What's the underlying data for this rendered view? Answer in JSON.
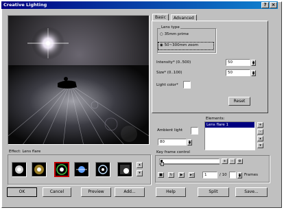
{
  "window": {
    "title": "Creative Lighting"
  },
  "tabs": [
    {
      "label": "Basic"
    },
    {
      "label": "Advanced"
    }
  ],
  "lens_type": {
    "group_title": "Lens type",
    "options": [
      {
        "label": "35mm prime",
        "selected": false
      },
      {
        "label": "50~300mm zoom",
        "selected": true
      }
    ]
  },
  "intensity": {
    "label": "Intensity* (0..500)",
    "value": "50"
  },
  "size": {
    "label": "Size* (0..100)",
    "value": "50"
  },
  "light_color": {
    "label": "Light color*"
  },
  "reset_label": "Reset",
  "elements": {
    "label": "Elements:",
    "items": [
      "Lens flare 1"
    ]
  },
  "ambient_light": {
    "label": "Ambient light",
    "value": "80"
  },
  "effect_strip": {
    "label": "Effect:",
    "value": "Lens flare"
  },
  "keyframe": {
    "title": "Key frame control",
    "current": "1",
    "total": "/ 10",
    "frames_label": "Frames"
  },
  "buttons": {
    "ok": "OK",
    "cancel": "Cancel",
    "preview": "Preview",
    "add": "Add...",
    "help": "Help",
    "split": "Split",
    "save": "Save..."
  },
  "colors": {
    "title_start": "#000080",
    "title_end": "#1084d0",
    "selection": "#000080",
    "face": "#c0c0c0"
  },
  "icons": [
    "help-icon",
    "close-icon",
    "play-icon",
    "stop-icon",
    "settings-icon"
  ]
}
